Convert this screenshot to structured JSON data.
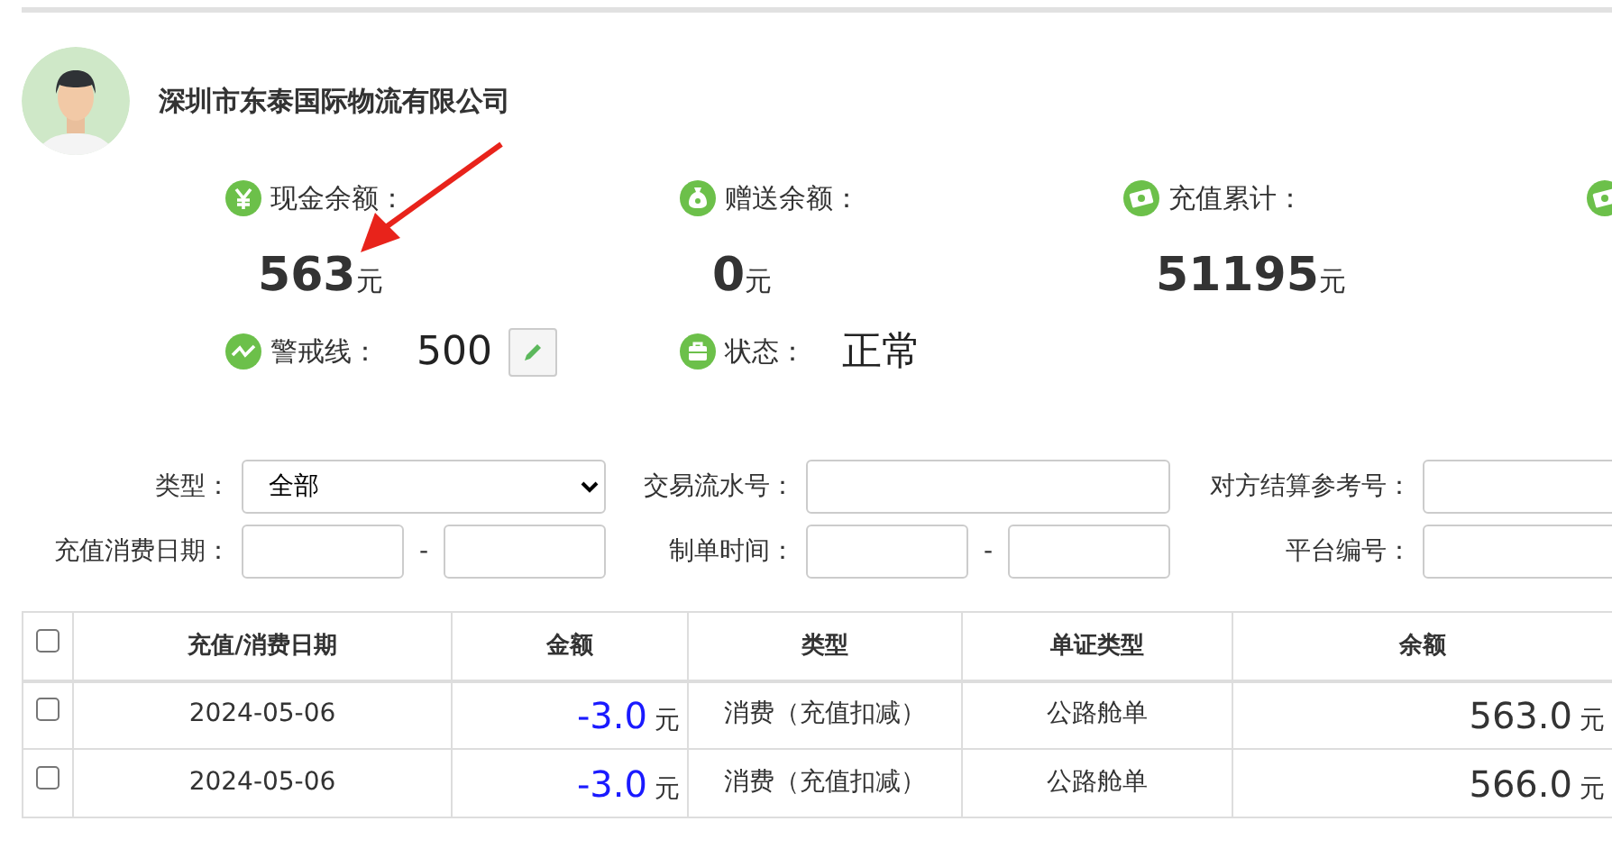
{
  "company": {
    "name": "深圳市东泰国际物流有限公司"
  },
  "stats": [
    {
      "kind": "yuan",
      "label": "现金余额：",
      "value": "563",
      "unit": "元"
    },
    {
      "kind": "money-bag",
      "label": "赠送余额：",
      "value": "0",
      "unit": "元"
    },
    {
      "kind": "cash",
      "label": "充值累计：",
      "value": "51195",
      "unit": "元"
    },
    {
      "kind": "cash"
    }
  ],
  "status_row": [
    {
      "kind": "edit",
      "label": "警戒线：",
      "value": "500"
    },
    {
      "kind": "briefcase",
      "label": "状态：",
      "value": "正常"
    }
  ],
  "filters": [
    {
      "kind": "select",
      "label": "类型：",
      "value": "全部"
    },
    {
      "kind": "text",
      "label": "交易流水号："
    },
    {
      "kind": "text",
      "label": "对方结算参考号："
    },
    {
      "kind": "range",
      "label": "充值消费日期：",
      "separator": "-"
    },
    {
      "kind": "range",
      "label": "制单时间：",
      "separator": "-"
    },
    {
      "kind": "text",
      "label": "平台编号："
    }
  ],
  "table": {
    "header_checked": false,
    "columns": [
      "充值/消费日期",
      "金额",
      "类型",
      "单证类型",
      "余额"
    ],
    "rows": [
      {
        "checked": false,
        "date": "2024-05-06",
        "amount": "-3.0",
        "amount_unit": "元",
        "type": "消费（充值扣减）",
        "doc_type": "公路舱单",
        "balance": "563.0",
        "balance_unit": "元"
      },
      {
        "checked": false,
        "date": "2024-05-06",
        "amount": "-3.0",
        "amount_unit": "元",
        "type": "消费（充值扣减）",
        "doc_type": "公路舱单",
        "balance": "566.0",
        "balance_unit": "元"
      }
    ]
  }
}
